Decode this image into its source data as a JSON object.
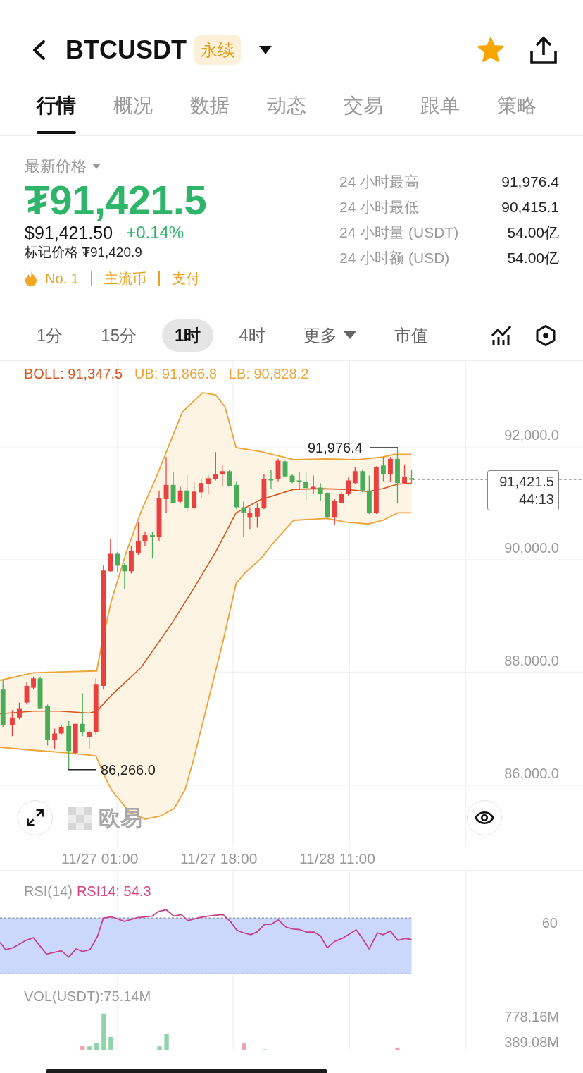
{
  "header": {
    "title": "BTCUSDT",
    "badge": "永续",
    "favorited": true
  },
  "tabs": [
    {
      "label": "行情",
      "selected": true
    },
    {
      "label": "概况",
      "selected": false
    },
    {
      "label": "数据",
      "selected": false
    },
    {
      "label": "动态",
      "selected": false
    },
    {
      "label": "交易",
      "selected": false
    },
    {
      "label": "跟单",
      "selected": false
    },
    {
      "label": "策略",
      "selected": false
    }
  ],
  "price": {
    "label": "最新价格",
    "last": "₮91,421.5",
    "usd": "$91,421.50",
    "change": "+0.14%",
    "mark_price": "标记价格 ₮91,420.9",
    "tags": [
      "No. 1",
      "主流币",
      "支付"
    ]
  },
  "stats": [
    {
      "label": "24 小时最高",
      "value": "91,976.4"
    },
    {
      "label": "24 小时最低",
      "value": "90,415.1"
    },
    {
      "label": "24 小时量 (USDT)",
      "value": "54.00亿"
    },
    {
      "label": "24 小时额 (USD)",
      "value": "54.00亿"
    }
  ],
  "timeframes": [
    {
      "label": "1分",
      "kind": "option",
      "selected": false
    },
    {
      "label": "15分",
      "kind": "option",
      "selected": false
    },
    {
      "label": "1时",
      "kind": "option",
      "selected": true
    },
    {
      "label": "4时",
      "kind": "option",
      "selected": false
    },
    {
      "label": "更多",
      "kind": "menu",
      "selected": false
    },
    {
      "label": "市值",
      "kind": "option",
      "selected": false
    }
  ],
  "chart": {
    "legend": [
      {
        "label": "BOLL: 91,347.5",
        "color": "#d8561f"
      },
      {
        "label": "UB: 91,866.8",
        "color": "#eba53a"
      },
      {
        "label": "LB: 90,828.2",
        "color": "#eba53a"
      }
    ],
    "y_labels": [
      "92,000.0",
      "90,000.0",
      "88,000.0",
      "86,000.0"
    ],
    "high_marker": "91,976.4",
    "low_marker": "86,266.0",
    "price_tag": {
      "price": "91,421.5",
      "countdown": "44:13"
    },
    "watermark": "欧易"
  },
  "time_axis": [
    "11/27 01:00",
    "11/27 18:00",
    "11/28 11:00"
  ],
  "rsi": {
    "name": "RSI(14)",
    "value": "RSI14: 54.3",
    "y_label": "60"
  },
  "volume": {
    "name": "VOL(USDT):75.14M",
    "y_labels": [
      "778.16M",
      "389.08M"
    ]
  }
}
